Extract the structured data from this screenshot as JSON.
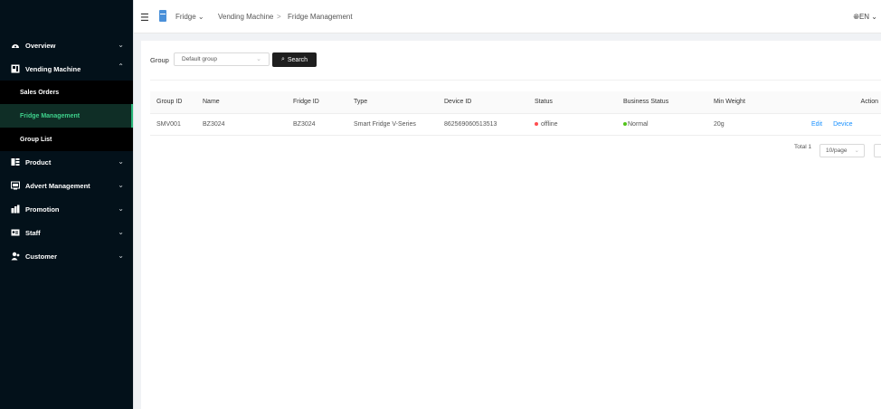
{
  "header": {
    "breadcrumb_root": "Fridge",
    "breadcrumb_section": "Vending Machine",
    "breadcrumb_sep": ">",
    "breadcrumb_page": "Fridge Management",
    "language": "EN"
  },
  "sidebar": {
    "items": [
      {
        "label": "Overview",
        "icon": "dashboard-icon"
      },
      {
        "label": "Vending Machine",
        "icon": "vending-machine-icon",
        "expanded": true,
        "children": [
          {
            "label": "Sales Orders"
          },
          {
            "label": "Fridge Management",
            "active": true
          },
          {
            "label": "Group List"
          }
        ]
      },
      {
        "label": "Product",
        "icon": "product-icon"
      },
      {
        "label": "Advert Management",
        "icon": "advert-icon"
      },
      {
        "label": "Promotion",
        "icon": "promotion-icon"
      },
      {
        "label": "Staff",
        "icon": "staff-icon"
      },
      {
        "label": "Customer",
        "icon": "customer-icon"
      }
    ]
  },
  "filter": {
    "group_label": "Group",
    "group_value": "Default group",
    "search_label": "Search"
  },
  "table": {
    "columns": [
      "Group ID",
      "Name",
      "Fridge ID",
      "Type",
      "Device ID",
      "Status",
      "Business Status",
      "Min Weight",
      "Action"
    ],
    "rows": [
      {
        "group_id": "SMV001",
        "name": "BZ3024",
        "fridge_id": "BZ3024",
        "type": "Smart Fridge V-Series",
        "device_id": "862569060513513",
        "status": "offline",
        "business_status": "Normal",
        "min_weight": "20g",
        "actions": [
          "Edit",
          "Device"
        ]
      }
    ]
  },
  "pagination": {
    "total_text": "Total 1",
    "page_size": "10/page"
  },
  "colors": {
    "sidebar_bg": "#03111a",
    "active_text": "#3ed08b",
    "status_offline": "#ff4d4f",
    "status_normal": "#52c41a",
    "link": "#1890ff"
  }
}
